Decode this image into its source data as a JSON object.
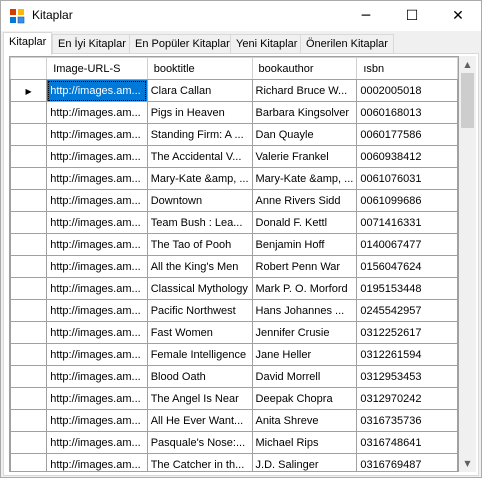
{
  "window": {
    "title": "Kitaplar",
    "minimize": "─",
    "maximize": "☐",
    "close": "✕"
  },
  "tabs": [
    {
      "label": "Kitaplar",
      "active": true
    },
    {
      "label": "En İyi Kitaplar"
    },
    {
      "label": "En Popüler Kitaplar"
    },
    {
      "label": "Yeni Kitaplar"
    },
    {
      "label": "Önerilen Kitaplar"
    }
  ],
  "grid": {
    "columns": [
      "Image-URL-S",
      "booktitle",
      "bookauthor",
      "ısbn"
    ],
    "current_row_marker": "▶",
    "rows": [
      [
        "http://images.am...",
        "Clara Callan",
        "Richard Bruce W...",
        "0002005018"
      ],
      [
        "http://images.am...",
        "Pigs in Heaven",
        "Barbara Kingsolver",
        "0060168013"
      ],
      [
        "http://images.am...",
        "Standing Firm: A ...",
        "Dan Quayle",
        "0060177586"
      ],
      [
        "http://images.am...",
        "The Accidental V...",
        "Valerie Frankel",
        "0060938412"
      ],
      [
        "http://images.am...",
        "Mary-Kate &amp, ...",
        "Mary-Kate &amp, ...",
        "0061076031"
      ],
      [
        "http://images.am...",
        "Downtown",
        "Anne Rivers Sidd",
        "0061099686"
      ],
      [
        "http://images.am...",
        "Team Bush : Lea...",
        "Donald F. Kettl",
        "0071416331"
      ],
      [
        "http://images.am...",
        "The Tao of Pooh",
        "Benjamin Hoff",
        "0140067477"
      ],
      [
        "http://images.am...",
        "All the King's Men",
        "Robert Penn War",
        "0156047624"
      ],
      [
        "http://images.am...",
        "Classical Mythology",
        "Mark P. O. Morford",
        "0195153448"
      ],
      [
        "http://images.am...",
        "Pacific Northwest",
        "Hans Johannes ...",
        "0245542957"
      ],
      [
        "http://images.am...",
        "Fast Women",
        "Jennifer Crusie",
        "0312252617"
      ],
      [
        "http://images.am...",
        "Female Intelligence",
        "Jane Heller",
        "0312261594"
      ],
      [
        "http://images.am...",
        "Blood Oath",
        "David Morrell",
        "0312953453"
      ],
      [
        "http://images.am...",
        "The Angel Is Near",
        "Deepak Chopra",
        "0312970242"
      ],
      [
        "http://images.am...",
        "All He Ever Want...",
        "Anita Shreve",
        "0316735736"
      ],
      [
        "http://images.am...",
        "Pasquale's Nose:...",
        "Michael Rips",
        "0316748641"
      ],
      [
        "http://images.am...",
        "The Catcher in th...",
        "J.D. Salinger",
        "0316769487"
      ]
    ]
  },
  "scrollbar": {
    "up": "▲",
    "down": "▼"
  },
  "colors": {
    "selection": "#0078d7",
    "grid_background": "#ababab"
  }
}
